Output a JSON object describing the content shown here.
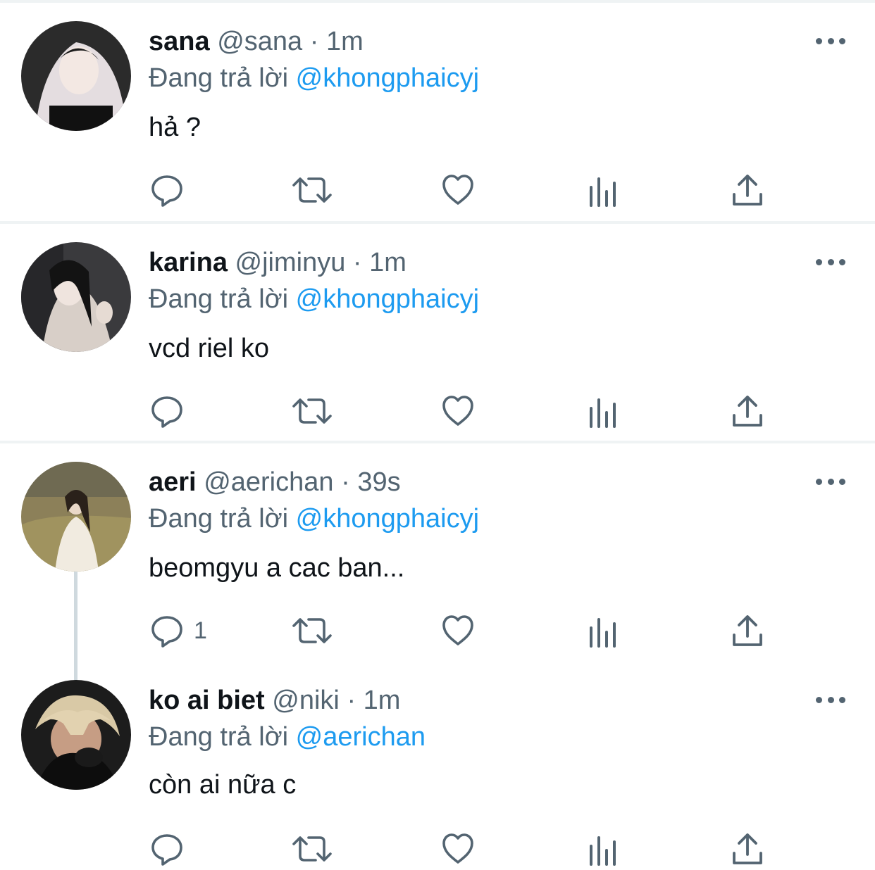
{
  "tweets": [
    {
      "name": "sana",
      "handle": "@sana",
      "dot": "·",
      "time": "1m",
      "reply_prefix": "Đang trả lời",
      "reply_to": "@khongphaicyj",
      "text": "hả ?",
      "reply_count": "",
      "avatar": {
        "palette": [
          "#1c1c1c",
          "#e8e2e4",
          "#f2e9e6"
        ]
      }
    },
    {
      "name": "karina",
      "handle": "@jiminyu",
      "dot": "·",
      "time": "1m",
      "reply_prefix": "Đang trả lời",
      "reply_to": "@khongphaicyj",
      "text": "vcd riel ko",
      "reply_count": "",
      "avatar": {
        "palette": [
          "#2a2a2c",
          "#d9d2cc",
          "#141414"
        ]
      }
    },
    {
      "name": "aeri",
      "handle": "@aerichan",
      "dot": "·",
      "time": "39s",
      "reply_prefix": "Đang trả lời",
      "reply_to": "@khongphaicyj",
      "text": "beomgyu a cac ban...",
      "reply_count": "1",
      "avatar": {
        "palette": [
          "#8a7d58",
          "#f1ece2",
          "#2a211a"
        ]
      }
    },
    {
      "name": "ko ai biet",
      "handle": "@niki",
      "dot": "·",
      "time": "1m",
      "reply_prefix": "Đang trả lời",
      "reply_to": "@aerichan",
      "text": "còn ai nữa c",
      "reply_count": "",
      "avatar": {
        "palette": [
          "#1a1a1a",
          "#d8c9a8",
          "#c49a80"
        ]
      }
    }
  ],
  "colors": {
    "icon": "#536471",
    "mention": "#1d9bf0",
    "separator": "#eff3f4",
    "thread_line": "#cfd9de"
  },
  "icons": [
    "reply-icon",
    "retweet-icon",
    "like-icon",
    "views-icon",
    "share-icon",
    "more-icon"
  ]
}
